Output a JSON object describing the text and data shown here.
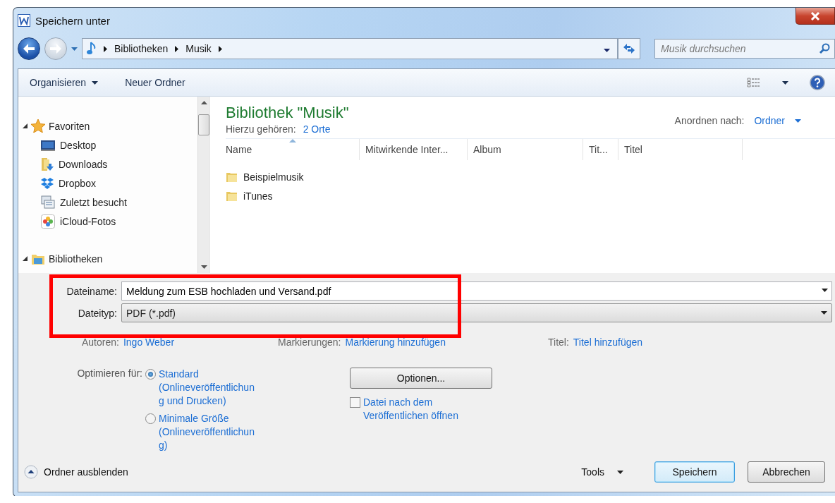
{
  "window": {
    "title": "Speichern unter"
  },
  "address": {
    "breadcrumbs": [
      "Bibliotheken",
      "Musik"
    ]
  },
  "search": {
    "placeholder": "Musik durchsuchen"
  },
  "toolbar": {
    "items": [
      {
        "label": "Organisieren",
        "kind": "menu"
      },
      {
        "label": "Neuer Ordner",
        "kind": "button"
      }
    ]
  },
  "sidebar": {
    "groups": [
      {
        "label": "Favoriten",
        "kind": "favorites",
        "expanded": true,
        "children": [
          {
            "label": "Desktop",
            "kind": "desktop"
          },
          {
            "label": "Downloads",
            "kind": "downloads"
          },
          {
            "label": "Dropbox",
            "kind": "dropbox"
          },
          {
            "label": "Zuletzt besucht",
            "kind": "recent"
          },
          {
            "label": "iCloud-Fotos",
            "kind": "photos"
          }
        ]
      },
      {
        "label": "Bibliotheken",
        "kind": "libraries",
        "expanded": true
      }
    ]
  },
  "library": {
    "title": "Bibliothek \"Musik\"",
    "subtitle": "Hierzu gehören:",
    "locations": "2 Orte",
    "arrange_label": "Anordnen nach:",
    "arrange_value": "Ordner"
  },
  "table": {
    "columns": [
      {
        "label": "Name",
        "sorted": true
      },
      {
        "label": "Mitwirkende Inter...",
        "sorted": false
      },
      {
        "label": "Album",
        "sorted": false
      },
      {
        "label": "Tit...",
        "sorted": false
      },
      {
        "label": "Titel",
        "sorted": false
      }
    ],
    "rows": [
      {
        "name": "Beispielmusik"
      },
      {
        "name": "iTunes"
      }
    ]
  },
  "form": {
    "filename": {
      "label": "Dateiname:",
      "value": "Meldung zum ESB hochladen und Versand.pdf"
    },
    "filetype": {
      "label": "Dateityp:",
      "value": "PDF (*.pdf)"
    },
    "meta": [
      {
        "label": "Autoren:",
        "value": "Ingo Weber"
      },
      {
        "label": "Markierungen:",
        "value": "Markierung hinzufügen"
      },
      {
        "label": "Titel:",
        "value": "Titel hinzufügen"
      }
    ],
    "optimize_label": "Optimieren für:",
    "optimize_options": [
      {
        "label": "Standard (Onlineveröffentlichung und Drucken)",
        "selected": true
      },
      {
        "label": "Minimale Größe (Onlineveröffentlichung)",
        "selected": false
      }
    ],
    "options_button": "Optionen...",
    "open_after": {
      "label": "Datei nach dem Veröffentlichen öffnen",
      "checked": false
    }
  },
  "footer": {
    "hide_folders": "Ordner ausblenden",
    "tools": "Tools",
    "buttons": [
      {
        "label": "Speichern",
        "default": true
      },
      {
        "label": "Abbrechen",
        "default": false
      }
    ]
  }
}
